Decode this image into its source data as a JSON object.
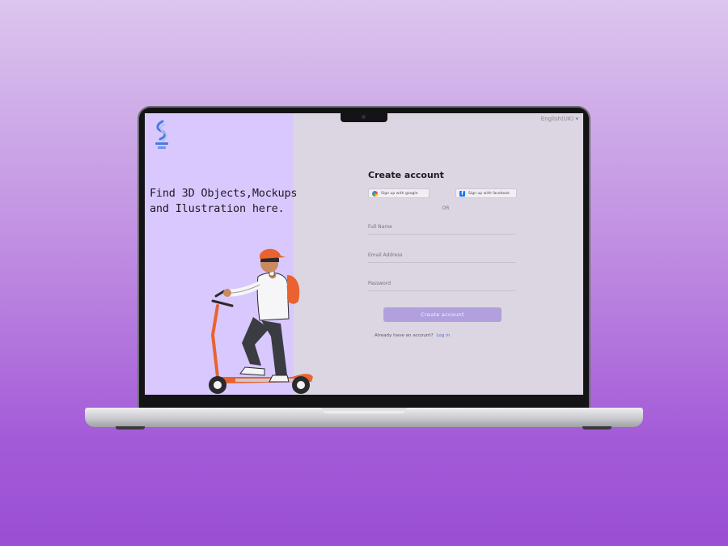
{
  "screen": {
    "language": "English(UK) ▾",
    "hero": {
      "line1": "Find 3D Objects,Mockups",
      "line2": "and Ilustration here."
    },
    "form": {
      "title": "Create account",
      "google_label": "Sign up with google",
      "facebook_label": "Sign up with facebook",
      "or_label": "OR",
      "full_name_placeholder": "Full Name",
      "email_placeholder": "Email Address",
      "password_placeholder": "Password",
      "submit_label": "Create account",
      "already_text": "Already have an account?",
      "login_link": "Log in"
    }
  },
  "colors": {
    "left_panel": "#d8c8fd",
    "right_panel": "#dcd6e2",
    "primary_button": "#b1a0dd",
    "link": "#4d6fd1"
  },
  "icons": [
    "logo-icon",
    "google-icon",
    "facebook-icon",
    "scooter-illustration"
  ]
}
